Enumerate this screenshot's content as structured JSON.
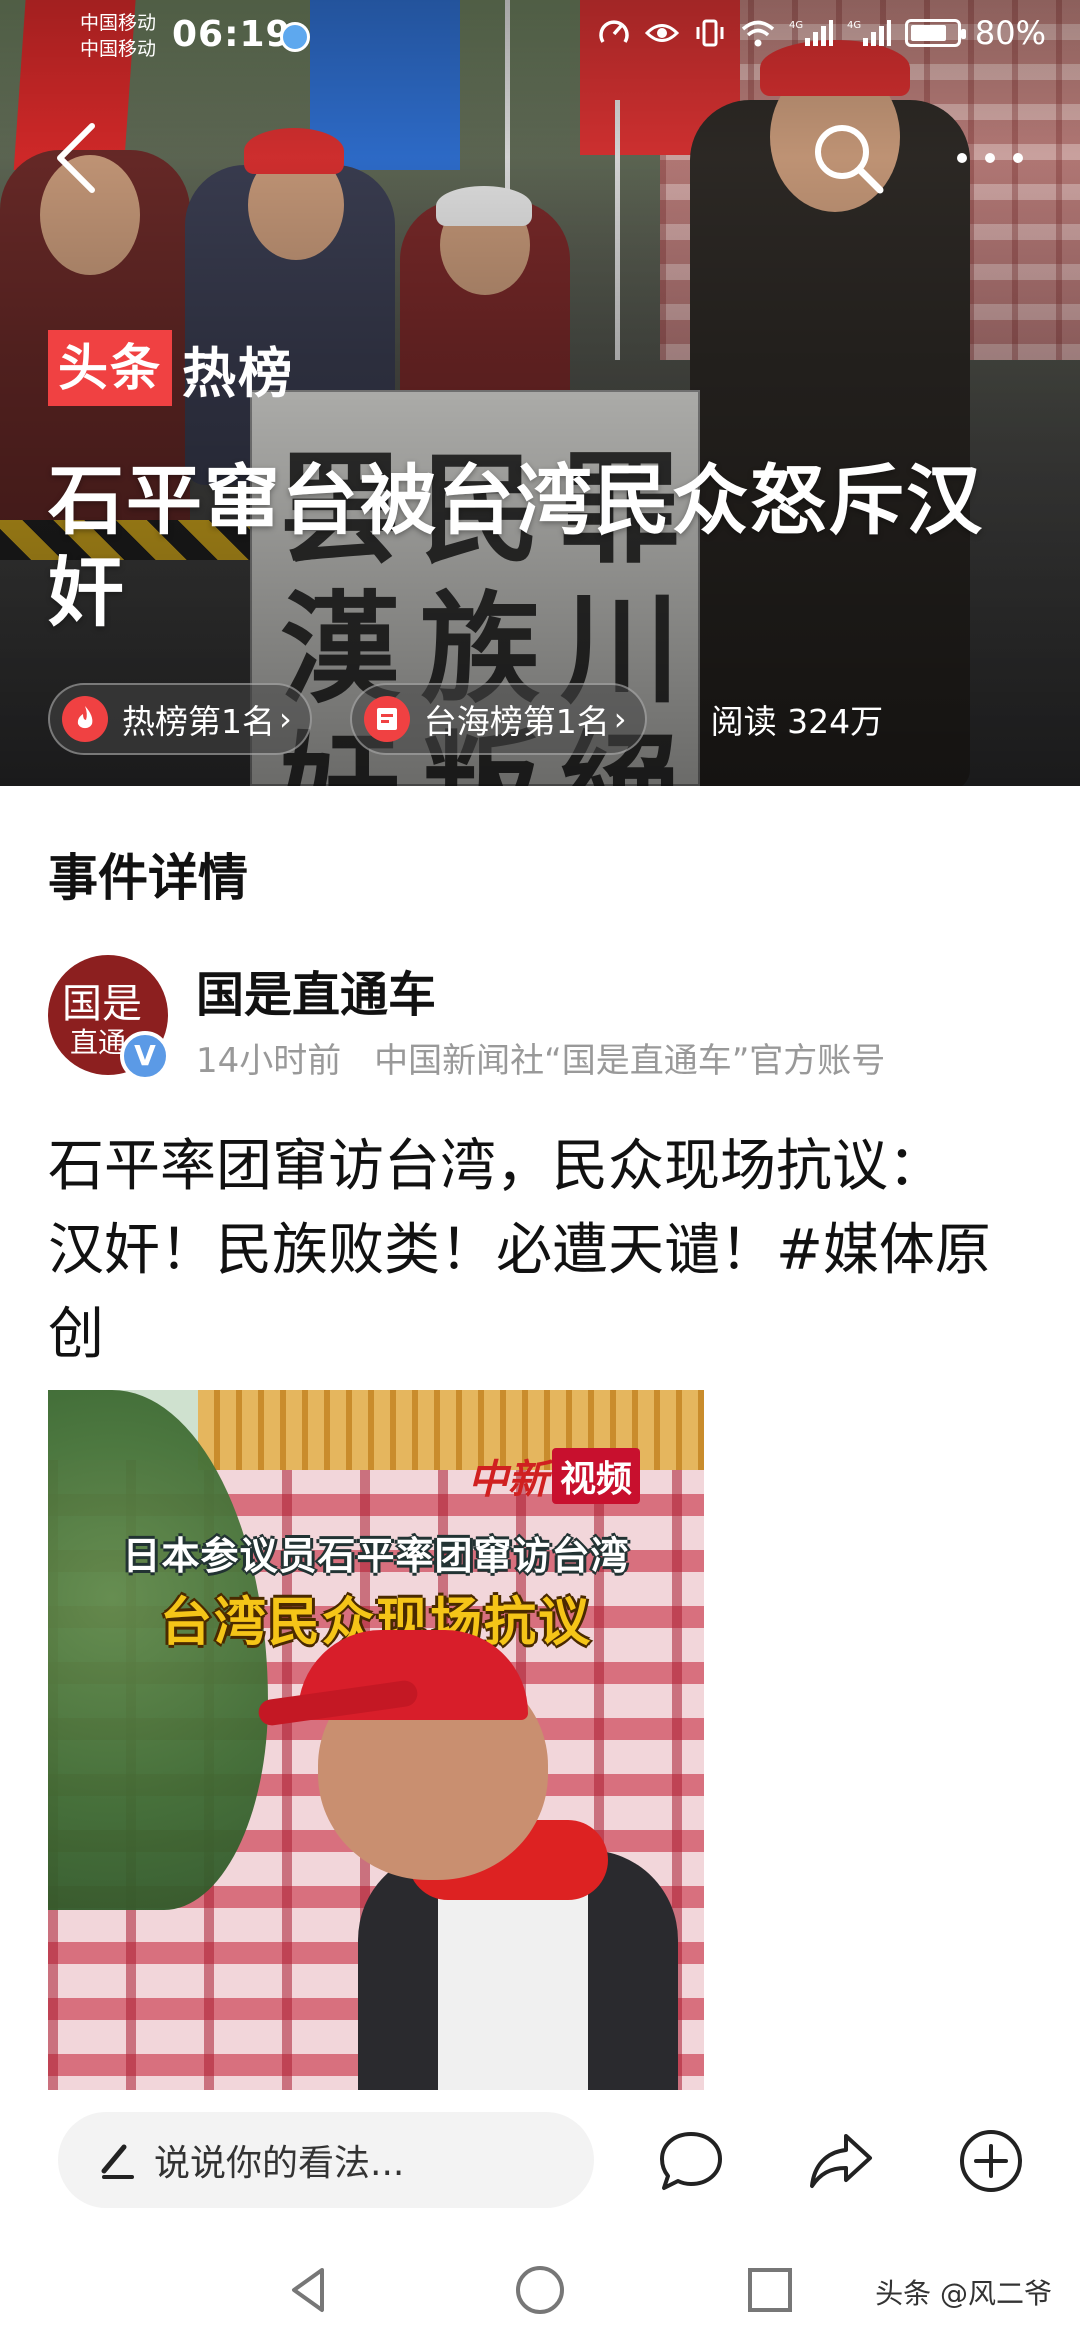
{
  "status_bar": {
    "carrier_1": "中国移动",
    "carrier_2": "中国移动",
    "time": "06:19",
    "battery_percent": "80%",
    "battery_level": 0.8
  },
  "hero": {
    "badge_red": "头条",
    "badge_white": "热榜",
    "title": "石平窜台被台湾民众怒斥汉奸",
    "chips": [
      {
        "label": "热榜第1名",
        "icon": "fire-icon"
      },
      {
        "label": "台海榜第1名",
        "icon": "list-icon"
      }
    ],
    "reads": "阅读 324万",
    "sign_chars": [
      "罢",
      "民",
      "罪",
      "漢",
      "族",
      "川",
      "奸",
      "叛",
      "絕"
    ]
  },
  "content": {
    "section_title": "事件详情",
    "author": {
      "name": "国是直通车",
      "avatar_text_1": "国是",
      "avatar_text_2": "直通",
      "verified_mark": "V",
      "time_ago": "14小时前",
      "description": "中国新闻社“国是直通车”官方账号"
    },
    "post_text": "石平率团窜访台湾，民众现场抗议： 汉奸！民族败类！必遭天谴！#媒体原创",
    "thumbnail": {
      "logo_1": "中新",
      "logo_2": "视频",
      "caption_1": "日本参议员石平率团窜访台湾",
      "caption_2": "台湾民众现场抗议"
    }
  },
  "bottom_bar": {
    "comment_placeholder": "说说你的看法...",
    "icons": [
      "comment-icon",
      "share-icon",
      "add-icon"
    ]
  },
  "system_nav": {
    "watermark": "头条 @风二爷"
  }
}
